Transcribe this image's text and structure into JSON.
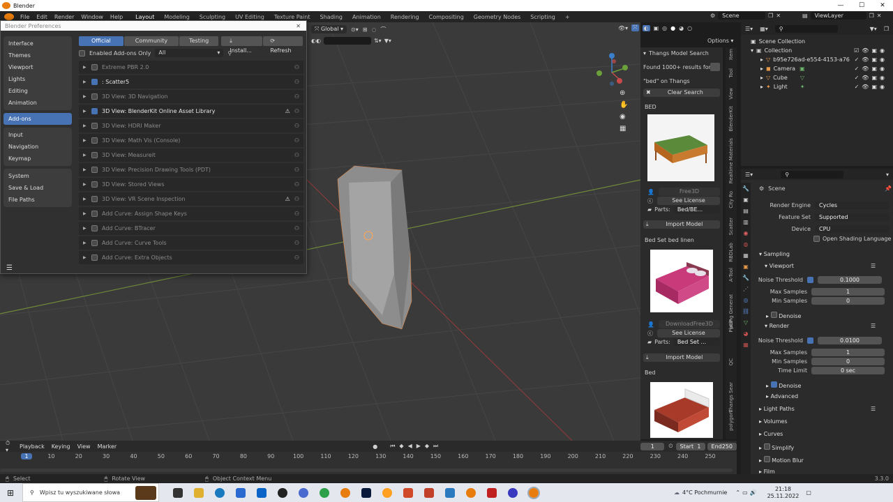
{
  "window": {
    "title": "Blender",
    "controls": [
      "—",
      "☐",
      "✕"
    ]
  },
  "topbar": {
    "menus": [
      "File",
      "Edit",
      "Render",
      "Window",
      "Help"
    ],
    "workspaces": [
      "Layout",
      "Modeling",
      "Sculpting",
      "UV Editing",
      "Texture Paint",
      "Shading",
      "Animation",
      "Rendering",
      "Compositing",
      "Geometry Nodes",
      "Scripting",
      "+"
    ],
    "active_workspace": "Layout",
    "scene": "Scene",
    "view_layer": "ViewLayer"
  },
  "viewport_header": {
    "orientation": "Global",
    "search_placeholder": ""
  },
  "prefs": {
    "title": "Blender Preferences",
    "sidebar_groups": [
      [
        "Interface",
        "Themes",
        "Viewport",
        "Lights",
        "Editing",
        "Animation"
      ],
      [
        "Add-ons"
      ],
      [
        "Input",
        "Navigation",
        "Keymap"
      ],
      [
        "System",
        "Save & Load",
        "File Paths"
      ]
    ],
    "active": "Add-ons",
    "tabs": [
      "Official",
      "Community",
      "Testing",
      "Install...",
      "Refresh"
    ],
    "enabled_only_label": "Enabled Add-ons Only",
    "category": "All",
    "addons": [
      {
        "name": "Extreme PBR 2.0",
        "enabled": false,
        "hidden_box": true,
        "warn": false
      },
      {
        "name": ": Scatter5",
        "enabled": true,
        "warn": false
      },
      {
        "name": "3D View: 3D Navigation",
        "enabled": false,
        "warn": false
      },
      {
        "name": "3D View: BlenderKit Online Asset Library",
        "enabled": true,
        "warn": true
      },
      {
        "name": "3D View: HDRI Maker",
        "enabled": false,
        "warn": false
      },
      {
        "name": "3D View: Math Vis (Console)",
        "enabled": false,
        "warn": false
      },
      {
        "name": "3D View: Measureit",
        "enabled": false,
        "warn": false
      },
      {
        "name": "3D View: Precision Drawing Tools (PDT)",
        "enabled": false,
        "warn": false
      },
      {
        "name": "3D View: Stored Views",
        "enabled": false,
        "warn": false
      },
      {
        "name": "3D View: VR Scene Inspection",
        "enabled": false,
        "warn": true
      },
      {
        "name": "Add Curve: Assign Shape Keys",
        "enabled": false,
        "warn": false
      },
      {
        "name": "Add Curve: BTracer",
        "enabled": false,
        "warn": false
      },
      {
        "name": "Add Curve: Curve Tools",
        "enabled": false,
        "warn": false
      },
      {
        "name": "Add Curve: Extra Objects",
        "enabled": false,
        "warn": false
      }
    ]
  },
  "thangs": {
    "header": "Thangs Model Search",
    "results": "Found 1000+ results for",
    "query": "\"bed\" on Thangs",
    "clear": "Clear Search",
    "items": [
      {
        "title": "BED",
        "source": "Free3D",
        "license": "See License",
        "parts_label": "Parts:",
        "parts": "Bed/BE...",
        "import": "Import Model"
      },
      {
        "title": "Bed Set bed linen",
        "source": "DownloadFree3D",
        "license": "See License",
        "parts_label": "Parts:",
        "parts": "Bed Set ...",
        "import": "Import Model"
      },
      {
        "title": "Bed"
      }
    ],
    "side_tabs": [
      "Item",
      "Tool",
      "View",
      "BlenderKit",
      "Realtime Materials",
      "City Ro",
      "Scatter",
      "RBDLab",
      "A-Tool",
      "Plating Generat",
      "pUP",
      "QC",
      "Thangs Sear",
      "polygoni"
    ]
  },
  "outliner": {
    "root": "Scene Collection",
    "items": [
      {
        "name": "Collection",
        "depth": 1
      },
      {
        "name": "b95e726ad-e554-4153-a76",
        "depth": 2
      },
      {
        "name": "Camera",
        "depth": 2
      },
      {
        "name": "Cube",
        "depth": 2
      },
      {
        "name": "Light",
        "depth": 2
      }
    ]
  },
  "properties": {
    "scene_label": "Scene",
    "render_engine": {
      "label": "Render Engine",
      "value": "Cycles"
    },
    "feature_set": {
      "label": "Feature Set",
      "value": "Supported"
    },
    "device": {
      "label": "Device",
      "value": "CPU"
    },
    "osl": "Open Shading Language",
    "sampling": "Sampling",
    "viewport": "Viewport",
    "vp_noise": {
      "label": "Noise Threshold",
      "value": "0.1000"
    },
    "vp_max": {
      "label": "Max Samples",
      "value": "1"
    },
    "vp_min": {
      "label": "Min Samples",
      "value": "0"
    },
    "denoise": "Denoise",
    "render": "Render",
    "r_noise": {
      "label": "Noise Threshold",
      "value": "0.0100"
    },
    "r_max": {
      "label": "Max Samples",
      "value": "1"
    },
    "r_min": {
      "label": "Min Samples",
      "value": "0"
    },
    "r_time": {
      "label": "Time Limit",
      "value": "0 sec"
    },
    "r_denoise": "Denoise",
    "advanced": "Advanced",
    "sections": [
      "Light Paths",
      "Volumes",
      "Curves",
      "Simplify",
      "Motion Blur",
      "Film"
    ]
  },
  "timeline": {
    "menus": [
      "Playback",
      "Keying",
      "View",
      "Marker"
    ],
    "current": "1",
    "start_label": "Start",
    "start": "1",
    "end_label": "End",
    "end": "250",
    "ticks": [
      "1",
      "10",
      "20",
      "30",
      "40",
      "50",
      "60",
      "70",
      "80",
      "90",
      "100",
      "110",
      "120",
      "130",
      "140",
      "150",
      "160",
      "170",
      "180",
      "190",
      "200",
      "210",
      "220",
      "230",
      "240",
      "250"
    ]
  },
  "status": {
    "select": "Select",
    "rotate": "Rotate View",
    "context": "Object Context Menu",
    "version": "3.3.0"
  },
  "taskbar": {
    "search": "Wpisz tu wyszukiwane słowa",
    "weather": "4°C Pochmurnie",
    "time": "21:18",
    "date": "25.11.2022"
  }
}
